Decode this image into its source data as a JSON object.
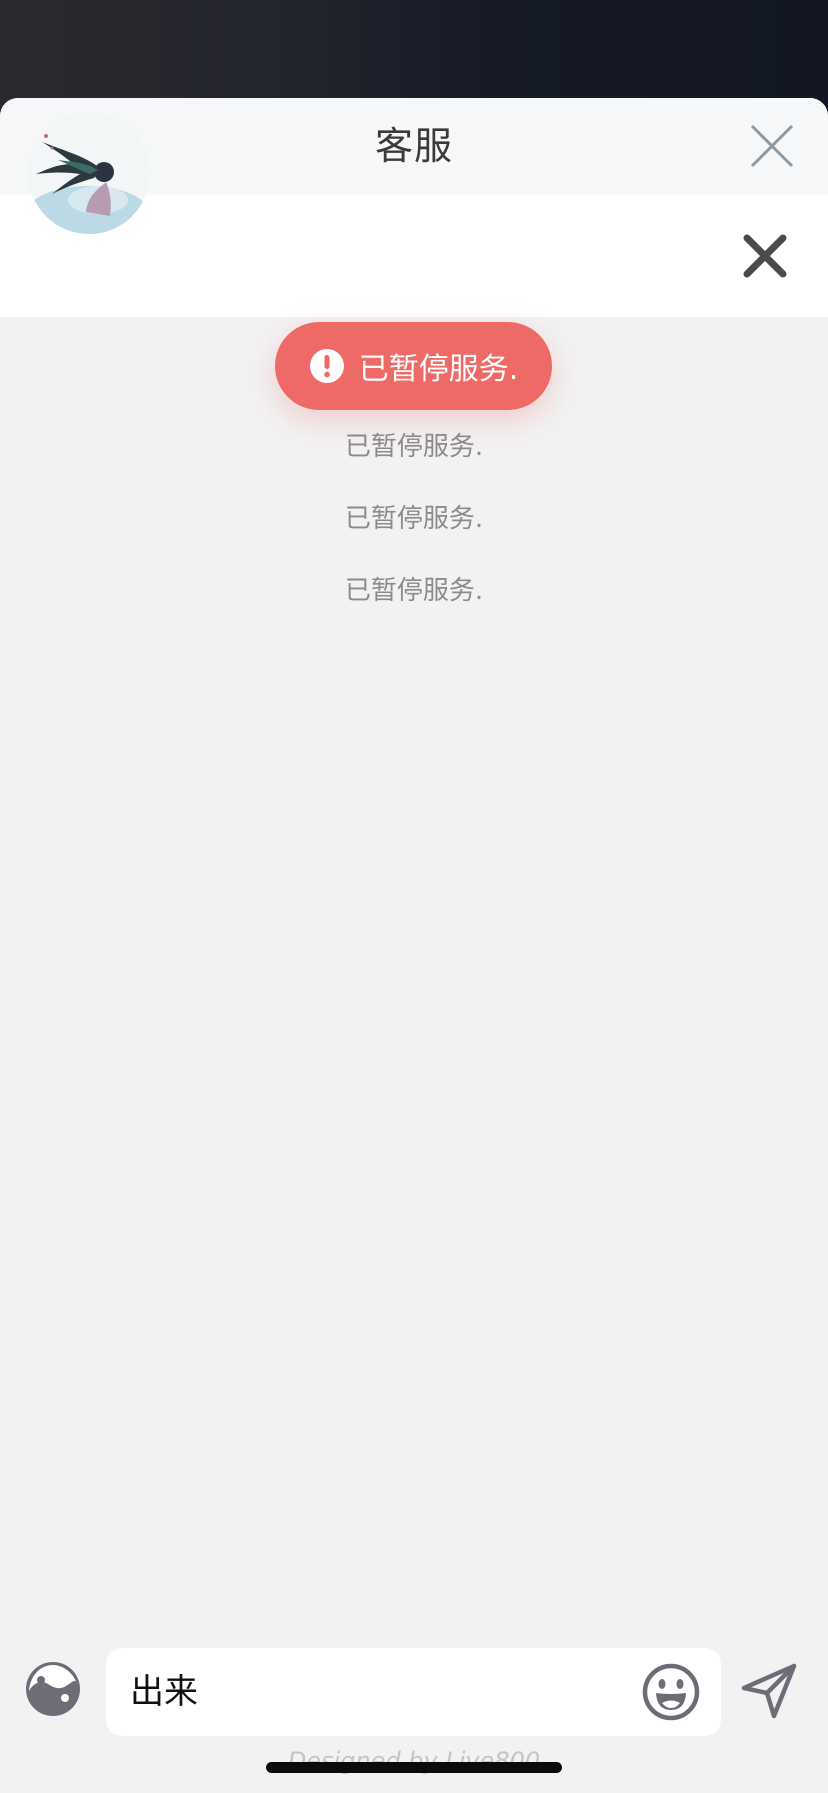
{
  "header": {
    "title": "客服"
  },
  "toast": {
    "message": "已暂停服务."
  },
  "messages": [
    {
      "text": "已暂停服务."
    },
    {
      "text": "已暂停服务."
    },
    {
      "text": "已暂停服务."
    }
  ],
  "composer": {
    "input_value": "出来"
  },
  "footer": {
    "credit": "Designed by Live800"
  },
  "icons": {
    "header_close": "close-icon",
    "agent_close": "close-icon",
    "toast": "exclamation-circle-icon",
    "left_action": "theme-toggle-icon",
    "emoji": "emoji-icon",
    "send": "send-icon"
  },
  "colors": {
    "toast": "#ee6a66",
    "background": "#f2f2f3",
    "header": "#f6f7f9"
  }
}
